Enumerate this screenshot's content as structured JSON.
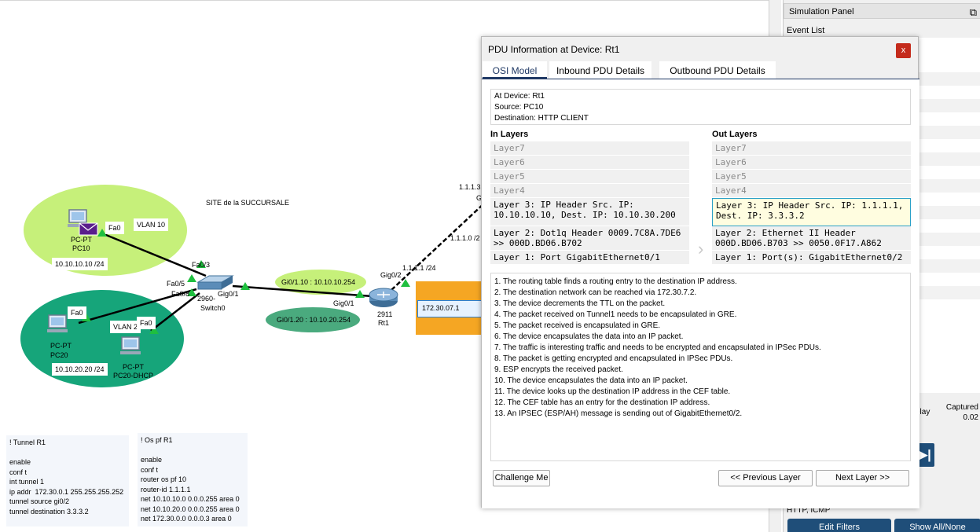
{
  "workspace": {
    "site_label": "SITE de la SUCCURSALE",
    "vlan10_label": "VLAN 10",
    "vlan20_label": "VLAN 2",
    "pc10": {
      "name1": "PC-PT",
      "name2": "PC10",
      "port": "Fa0",
      "ip": "10.10.10.10 /24"
    },
    "pc20": {
      "name1": "PC-PT",
      "name2": "PC20",
      "port": "Fa0",
      "ip": "10.10.20.20 /24"
    },
    "pc20dhcp": {
      "name1": "PC-PT",
      "name2": "PC20-DHCP",
      "port": "Fa0"
    },
    "switch": {
      "name1": "2960-",
      "name2": "Switch0",
      "p1": "Fa0/3",
      "p2": "Fa0/5",
      "p3": "Fa0/8",
      "uplink": "Gig0/1"
    },
    "router": {
      "name1": "2911",
      "name2": "Rt1",
      "g1": "Gig0/1",
      "g2": "Gig0/2"
    },
    "sub1": "Gi0/1.10 : 10.10.10.254",
    "sub2": "Gi0/1.20 : 10.10.20.254",
    "wan1": "1.1.1.1 /24",
    "wan2": "1.1.1.0 /2",
    "wan3": "1.1.1.3",
    "wan3b": "G",
    "tunnel_ip": "172.30.07.1",
    "notes_tunnel": "! Tunnel R1\n\nenable\nconf t\nint tunnel 1\nip addr  172.30.0.1 255.255.255.252\ntunnel source gi0/2\ntunnel destination 3.3.3.2",
    "notes_ospf": "! Os pf R1\n\nenable\nconf t\nrouter os pf 10\nrouter-id 1.1.1.1\nnet 10.10.10.0 0.0.0.255 area 0\nnet 10.10.20.0 0.0.0.255 area 0\nnet 172.30.0.0 0.0.0.3 area 0"
  },
  "sim_panel": {
    "title": "Simulation Panel",
    "restore_icon": "⧉",
    "event_list": "Event List",
    "delay": "elay",
    "captured": "Captured",
    "captured_val": "0.02",
    "play_icon": "▶|",
    "filters": "HTTP, ICMP",
    "edit_filters": "Edit Filters",
    "show_all": "Show All/None"
  },
  "dialog": {
    "title": "PDU Information at Device: Rt1",
    "close": "x",
    "tabs": [
      "OSI Model",
      "Inbound PDU Details",
      "Outbound PDU Details"
    ],
    "at_device": "At Device: Rt1",
    "source": "Source: PC10",
    "destination": "Destination: HTTP CLIENT",
    "in_layers_title": "In Layers",
    "out_layers_title": "Out Layers",
    "in_layers": [
      "Layer7",
      "Layer6",
      "Layer5",
      "Layer4",
      "Layer 3: IP Header Src. IP: 10.10.10.10, Dest. IP: 10.10.30.200",
      "Layer 2: Dot1q Header 0009.7C8A.7DE6 >> 000D.BD06.B702",
      "Layer 1: Port GigabitEthernet0/1"
    ],
    "out_layers": [
      "Layer7",
      "Layer6",
      "Layer5",
      "Layer4",
      "Layer 3: IP Header Src. IP: 1.1.1.1, Dest. IP: 3.3.3.2",
      "Layer 2: Ethernet II Header 000D.BD06.B703 >> 0050.0F17.A862",
      "Layer 1: Port(s): GigabitEthernet0/2"
    ],
    "steps": [
      "1. The routing table finds a routing entry to the destination IP address.",
      "2. The destination network can be reached via 172.30.7.2.",
      "3. The device decrements the TTL on the packet.",
      "4. The packet received on Tunnel1 needs to be encapsulated in GRE.",
      "5. The packet received is encapsulated in GRE.",
      "6. The device encapsulates the data into an IP packet.",
      "7. The traffic is interesting traffic and needs to be encrypted and encapsulated in IPSec PDUs.",
      "8. The packet is getting encrypted and encapsulated in IPSec PDUs.",
      "9. ESP encrypts the received packet.",
      "10. The device encapsulates the data into an IP packet.",
      "11. The device looks up the destination IP address in the CEF table.",
      "12. The CEF table has an entry for the destination IP address.",
      "13. An IPSEC (ESP/AH) message is sending out of GigabitEthernet0/2."
    ],
    "challenge": "Challenge Me",
    "prev": "<< Previous Layer",
    "next": "Next Layer >>"
  }
}
